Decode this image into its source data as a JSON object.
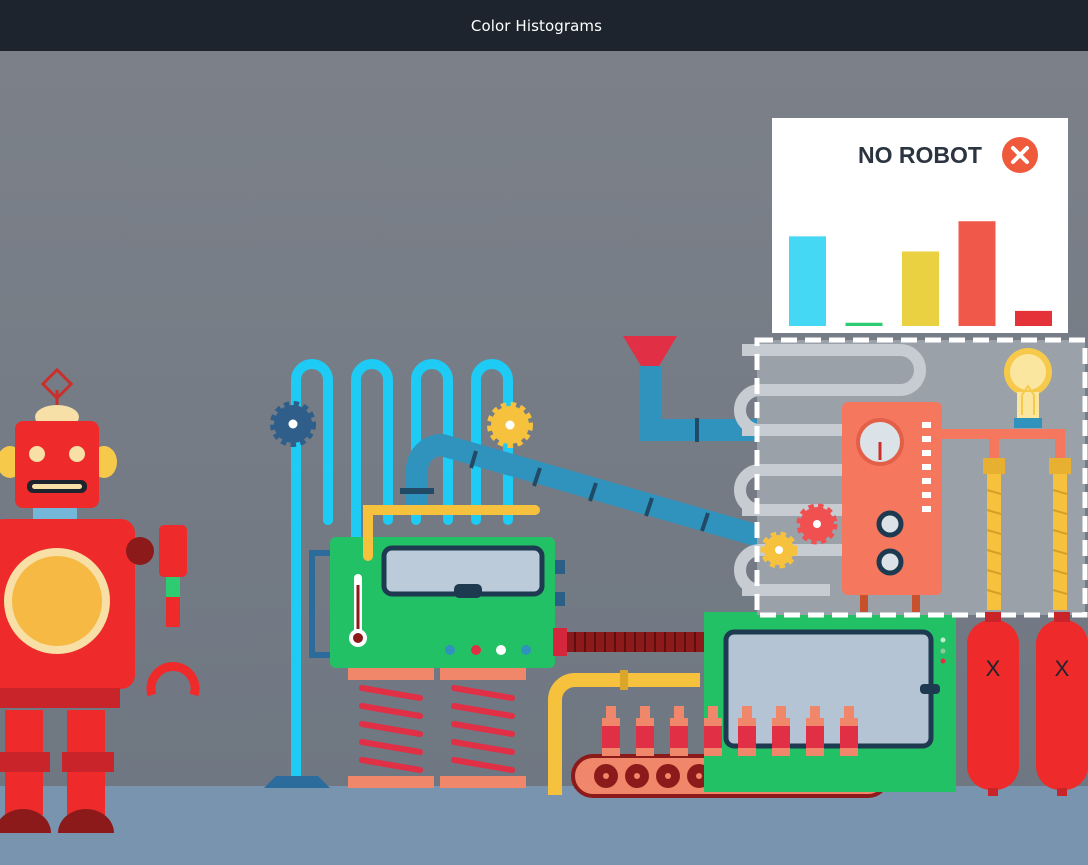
{
  "window": {
    "title": "Color Histograms"
  },
  "panel": {
    "label": "NO ROBOT",
    "status_icon": "close-icon",
    "histogram": {
      "type": "bar",
      "colors": [
        "#45d8f4",
        "#2ecc71",
        "#e9d142",
        "#f0584a",
        "#e53238"
      ],
      "values": [
        0.83,
        0.03,
        0.69,
        0.97,
        0.14
      ]
    }
  },
  "tanks": {
    "left_label": "X",
    "right_label": "X"
  },
  "colors": {
    "background": "#727a84",
    "floor": "#7894ae",
    "robot_red": "#ee2a2a",
    "machine_green": "#23c165",
    "pipe_blue": "#1ecbf4",
    "pipe_steel": "#2f93be",
    "panel_white": "#ffffff",
    "heater_orange": "#f5785e"
  }
}
